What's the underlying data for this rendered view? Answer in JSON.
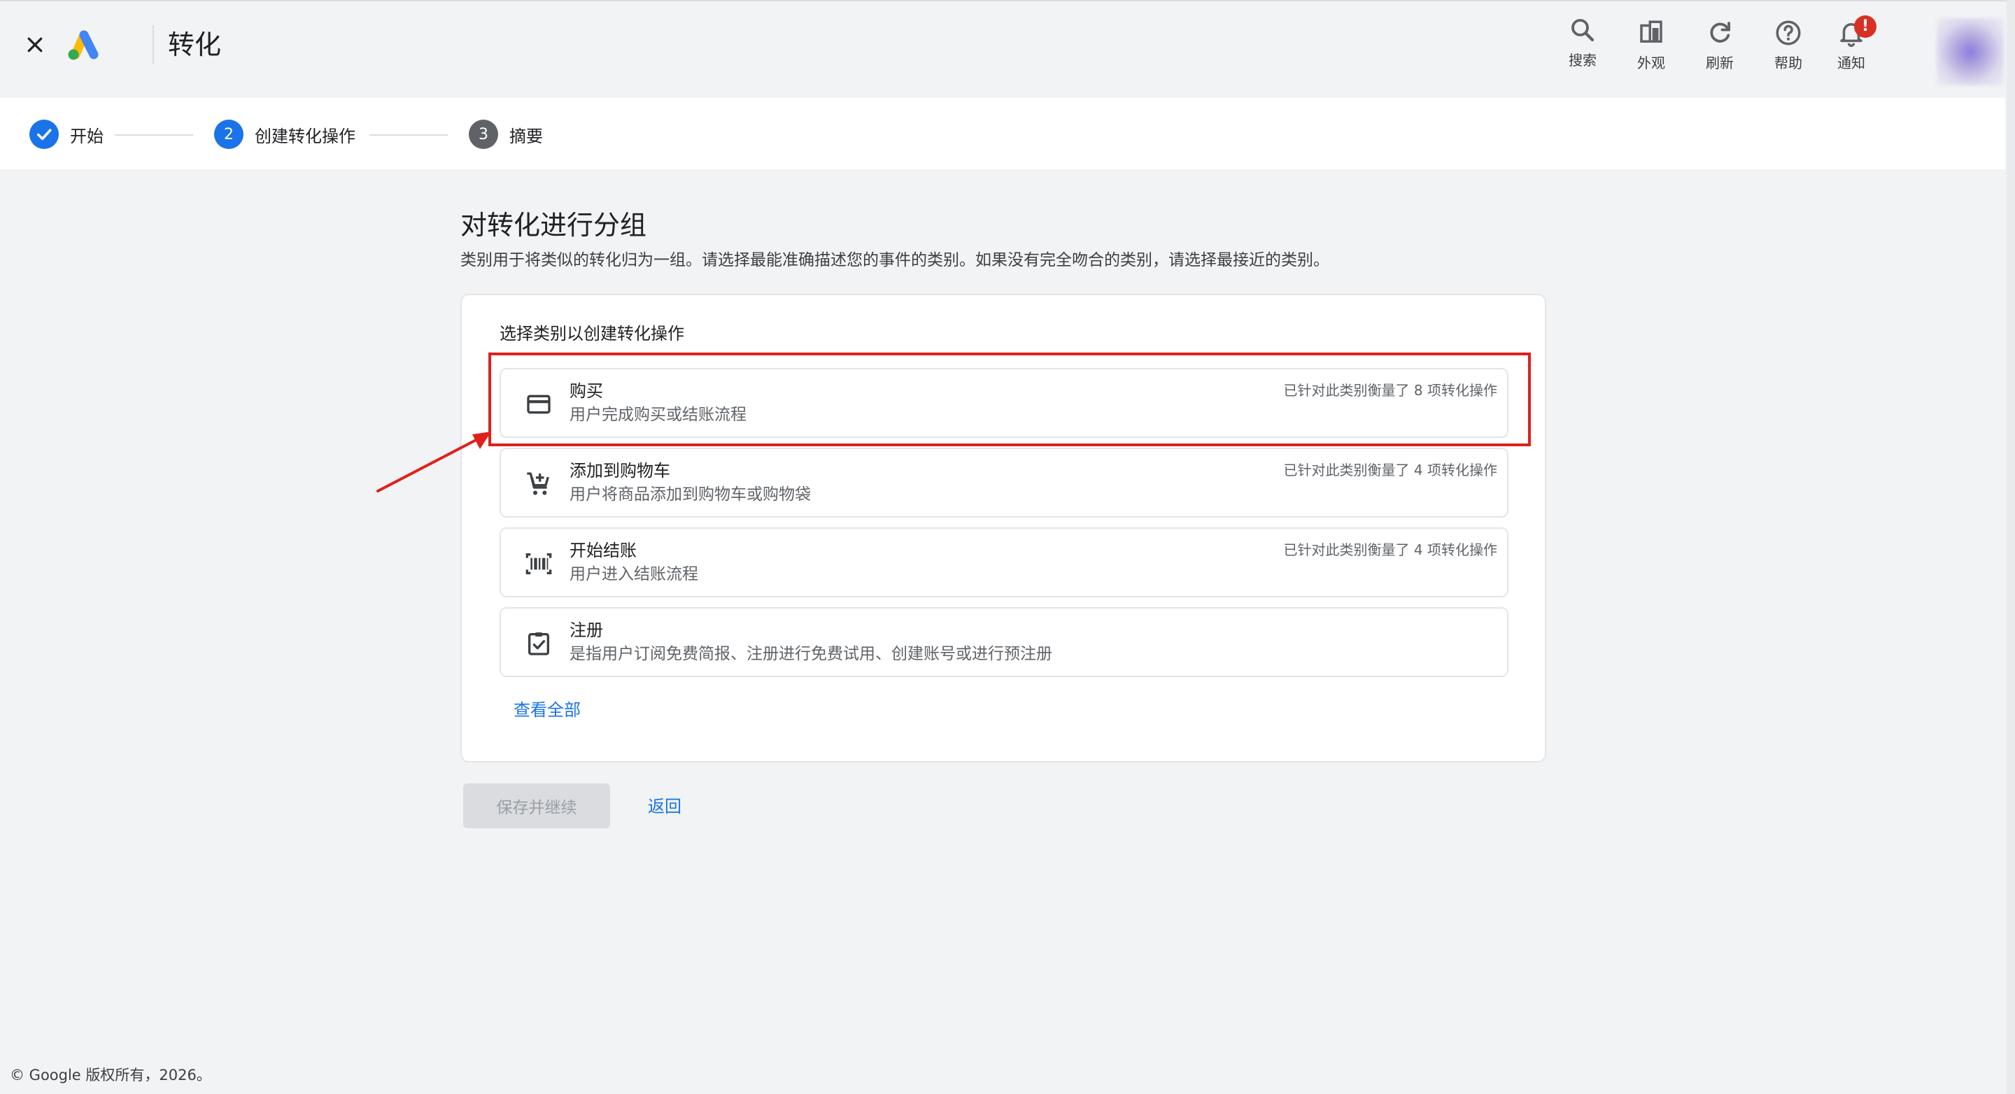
{
  "header": {
    "title": "转化",
    "tools": [
      {
        "label": "搜索",
        "icon": "search-icon"
      },
      {
        "label": "外观",
        "icon": "appearance-icon"
      },
      {
        "label": "刷新",
        "icon": "refresh-icon"
      },
      {
        "label": "帮助",
        "icon": "help-icon"
      },
      {
        "label": "通知",
        "icon": "notifications-icon"
      }
    ],
    "notification_badge": "!"
  },
  "stepper": {
    "steps": [
      {
        "number": "",
        "label": "开始",
        "state": "completed"
      },
      {
        "number": "2",
        "label": "创建转化操作",
        "state": "active"
      },
      {
        "number": "3",
        "label": "摘要",
        "state": "pending"
      }
    ]
  },
  "main": {
    "title": "对转化进行分组",
    "description": "类别用于将类似的转化归为一组。请选择最能准确描述您的事件的类别。如果没有完全吻合的类别，请选择最接近的类别。",
    "card_label": "选择类别以创建转化操作",
    "options": [
      {
        "title": "购买",
        "description": "用户完成购买或结账流程",
        "meta": "已针对此类别衡量了 8 项转化操作",
        "icon": "credit-card-icon"
      },
      {
        "title": "添加到购物车",
        "description": "用户将商品添加到购物车或购物袋",
        "meta": "已针对此类别衡量了 4 项转化操作",
        "icon": "add-shopping-cart-icon"
      },
      {
        "title": "开始结账",
        "description": "用户进入结账流程",
        "meta": "已针对此类别衡量了 4 项转化操作",
        "icon": "barcode-scanner-icon"
      },
      {
        "title": "注册",
        "description": "是指用户订阅免费简报、注册进行免费试用、创建账号或进行预注册",
        "meta": "",
        "icon": "clipboard-check-icon"
      }
    ],
    "view_all": "查看全部",
    "save_button": "保存并继续",
    "back_link": "返回"
  },
  "footer": {
    "copyright": "© Google 版权所有，2026。"
  },
  "colors": {
    "accent": "#1a73e8",
    "highlight": "#e0201b",
    "badge": "#d93025",
    "step_pending": "#5f6368"
  }
}
